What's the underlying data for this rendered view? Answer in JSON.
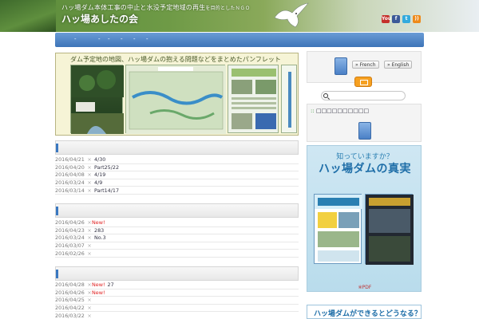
{
  "header": {
    "tagline_main": "ハッ場ダム本体工事の中止と水没予定地域の再生",
    "tagline_small": "を目的としたＮＧＯ",
    "site_title": "ハッ場あしたの会",
    "social": [
      {
        "name": "youtube-icon",
        "label": "You",
        "class": "yt"
      },
      {
        "name": "facebook-icon",
        "label": "f",
        "class": "fb"
      },
      {
        "name": "twitter-icon",
        "label": "t",
        "class": "tw"
      },
      {
        "name": "rss-icon",
        "label": "))",
        "class": "rss"
      }
    ]
  },
  "nav": {
    "items": [
      "-",
      "-",
      "-",
      "-",
      "-",
      "-"
    ]
  },
  "banner": {
    "title": "ダム予定地の地図、ハッ場ダムの抱える問題などをまとめたパンフレット"
  },
  "sections": [
    {
      "rows": [
        {
          "date": "2016/04/21",
          "bullet": "×",
          "new": "",
          "title": "4/30"
        },
        {
          "date": "2016/04/20",
          "bullet": "×",
          "new": "",
          "title": "Part25/22"
        },
        {
          "date": "2016/04/08",
          "bullet": "×",
          "new": "",
          "title": "4/19"
        },
        {
          "date": "2016/03/24",
          "bullet": "×",
          "new": "",
          "title": "4/9"
        },
        {
          "date": "2016/03/14",
          "bullet": "×",
          "new": "",
          "title": "Part14/17"
        }
      ]
    },
    {
      "rows": [
        {
          "date": "2016/04/26",
          "bullet": "×",
          "new": "New!",
          "title": ""
        },
        {
          "date": "2016/04/23",
          "bullet": "×",
          "new": "",
          "title": "283"
        },
        {
          "date": "2016/03/24",
          "bullet": "×",
          "new": "",
          "title": "No.3"
        },
        {
          "date": "2016/03/07",
          "bullet": "×",
          "new": "",
          "title": ""
        },
        {
          "date": "2016/02/26",
          "bullet": "×",
          "new": "",
          "title": ""
        }
      ]
    },
    {
      "rows": [
        {
          "date": "2016/04/28",
          "bullet": "×",
          "new": "New!",
          "title": "27"
        },
        {
          "date": "2016/04/26",
          "bullet": "×",
          "new": "New!",
          "title": ""
        },
        {
          "date": "2016/04/25",
          "bullet": "×",
          "new": "",
          "title": ""
        },
        {
          "date": "2016/04/22",
          "bullet": "×",
          "new": "",
          "title": ""
        },
        {
          "date": "2016/03/22",
          "bullet": "×",
          "new": "",
          "title": ""
        }
      ]
    }
  ],
  "sidebar": {
    "lang_french": "» French",
    "lang_english": "» English",
    "search_placeholder": "",
    "info_head": "□□□□□□□□□□",
    "ad_question": "知っていますか？",
    "ad_title": "ハッ場ダムの真実",
    "ad_pdf": "※PDF",
    "dam_link": "ハッ場ダムができるとどうなる？"
  },
  "colors": {
    "nav": "#3d74b8",
    "accent_blue": "#1e6ea8",
    "new_red": "#e02020",
    "mail_orange": "#f6a020"
  }
}
